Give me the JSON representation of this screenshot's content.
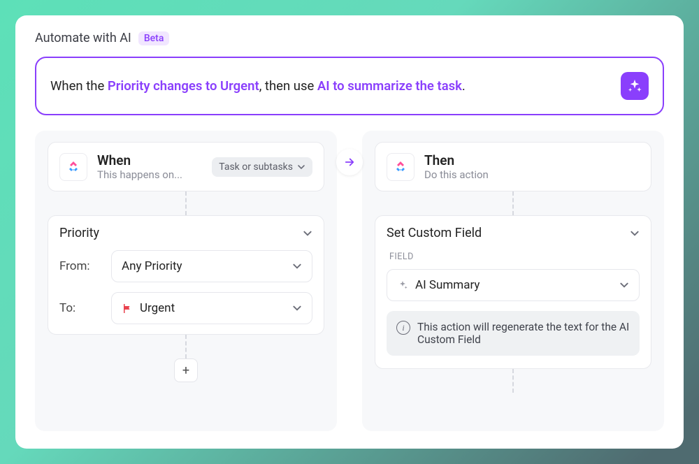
{
  "header": {
    "title": "Automate with AI",
    "badge": "Beta"
  },
  "prompt": {
    "prefix": "When the ",
    "trigger_phrase": "Priority changes to Urgent",
    "middle": ", then use ",
    "action_phrase": "AI to summarize the task",
    "suffix": "."
  },
  "flow": {
    "arrow_icon": "arrow-right"
  },
  "when": {
    "title": "When",
    "subtitle": "This happens on...",
    "scope": "Task or subtasks",
    "condition_field": "Priority",
    "from_label": "From:",
    "from_value": "Any Priority",
    "to_label": "To:",
    "to_value": "Urgent",
    "to_icon": "flag-icon",
    "add_icon": "+"
  },
  "then": {
    "title": "Then",
    "subtitle": "Do this action",
    "action": "Set Custom Field",
    "field_label": "FIELD",
    "field_value": "AI Summary",
    "field_icon": "sparkle-icon",
    "info": "This action will regenerate the text for the AI Custom Field"
  }
}
